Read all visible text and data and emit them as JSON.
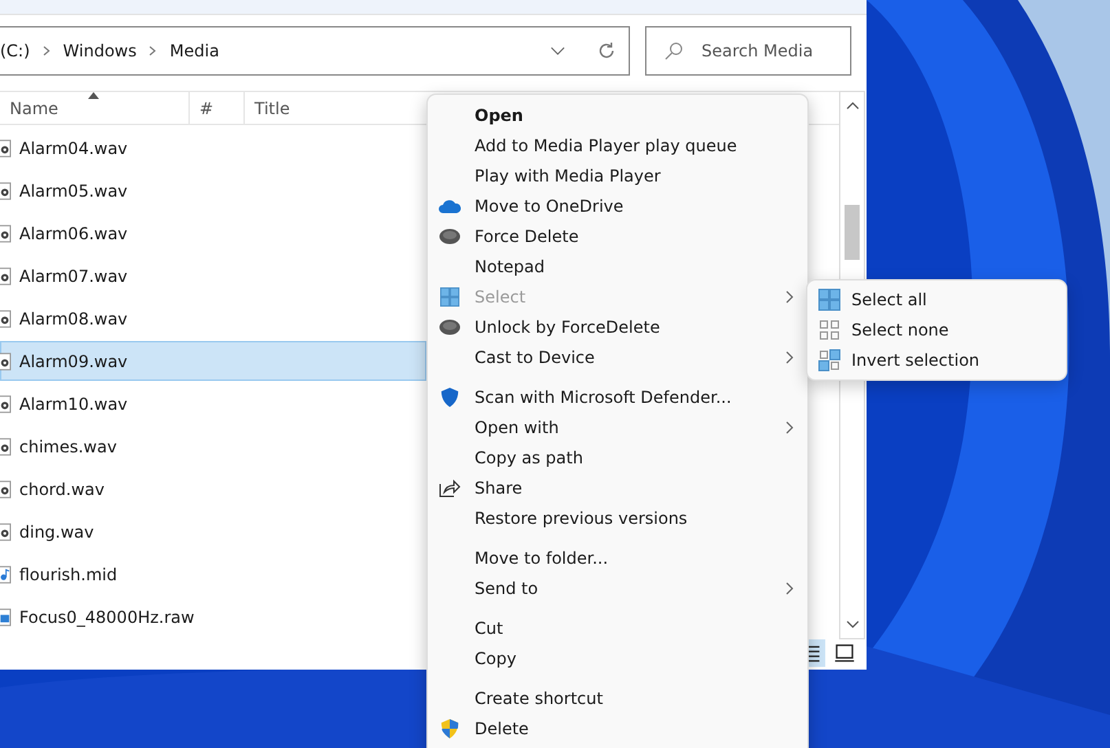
{
  "address_bar": {
    "path": [
      "(C:)",
      "Windows",
      "Media"
    ]
  },
  "search": {
    "placeholder": "Search Media"
  },
  "columns": [
    {
      "label": "Name",
      "sorted": true
    },
    {
      "label": "#",
      "sorted": false
    },
    {
      "label": "Title",
      "sorted": false
    }
  ],
  "files": [
    {
      "name": "Alarm04.wav",
      "kind": "audio",
      "selected": false
    },
    {
      "name": "Alarm05.wav",
      "kind": "audio",
      "selected": false
    },
    {
      "name": "Alarm06.wav",
      "kind": "audio",
      "selected": false
    },
    {
      "name": "Alarm07.wav",
      "kind": "audio",
      "selected": false
    },
    {
      "name": "Alarm08.wav",
      "kind": "audio",
      "selected": false
    },
    {
      "name": "Alarm09.wav",
      "kind": "audio",
      "selected": true
    },
    {
      "name": "Alarm10.wav",
      "kind": "audio",
      "selected": false
    },
    {
      "name": "chimes.wav",
      "kind": "audio",
      "selected": false
    },
    {
      "name": "chord.wav",
      "kind": "audio",
      "selected": false
    },
    {
      "name": "ding.wav",
      "kind": "audio",
      "selected": false
    },
    {
      "name": "flourish.mid",
      "kind": "midi",
      "selected": false
    },
    {
      "name": "Focus0_48000Hz.raw",
      "kind": "image",
      "selected": false
    }
  ],
  "context_menu": {
    "groups": [
      [
        {
          "label": "Open",
          "kind": "plain",
          "bold": true,
          "submenu": false,
          "disabled": false
        },
        {
          "label": "Add to Media Player play queue",
          "kind": "plain",
          "bold": false,
          "submenu": false,
          "disabled": false
        },
        {
          "label": "Play with Media Player",
          "kind": "plain",
          "bold": false,
          "submenu": false,
          "disabled": false
        },
        {
          "label": "Move to OneDrive",
          "kind": "cloud",
          "bold": false,
          "submenu": false,
          "disabled": false
        },
        {
          "label": "Force Delete",
          "kind": "disc",
          "bold": false,
          "submenu": false,
          "disabled": false
        },
        {
          "label": "Notepad",
          "kind": "plain",
          "bold": false,
          "submenu": false,
          "disabled": false
        },
        {
          "label": "Select",
          "kind": "grid",
          "bold": false,
          "submenu": true,
          "disabled": true
        },
        {
          "label": "Unlock by ForceDelete",
          "kind": "disc",
          "bold": false,
          "submenu": false,
          "disabled": false
        },
        {
          "label": "Cast to Device",
          "kind": "plain",
          "bold": false,
          "submenu": true,
          "disabled": false
        }
      ],
      [
        {
          "label": "Scan with Microsoft Defender...",
          "kind": "shield",
          "bold": false,
          "submenu": false,
          "disabled": false
        },
        {
          "label": "Open with",
          "kind": "plain",
          "bold": false,
          "submenu": true,
          "disabled": false
        },
        {
          "label": "Copy as path",
          "kind": "plain",
          "bold": false,
          "submenu": false,
          "disabled": false
        },
        {
          "label": "Share",
          "kind": "share",
          "bold": false,
          "submenu": false,
          "disabled": false
        },
        {
          "label": "Restore previous versions",
          "kind": "plain",
          "bold": false,
          "submenu": false,
          "disabled": false
        }
      ],
      [
        {
          "label": "Move to folder...",
          "kind": "plain",
          "bold": false,
          "submenu": false,
          "disabled": false
        },
        {
          "label": "Send to",
          "kind": "plain",
          "bold": false,
          "submenu": true,
          "disabled": false
        }
      ],
      [
        {
          "label": "Cut",
          "kind": "plain",
          "bold": false,
          "submenu": false,
          "disabled": false
        },
        {
          "label": "Copy",
          "kind": "plain",
          "bold": false,
          "submenu": false,
          "disabled": false
        }
      ],
      [
        {
          "label": "Create shortcut",
          "kind": "plain",
          "bold": false,
          "submenu": false,
          "disabled": false
        },
        {
          "label": "Delete",
          "kind": "uac",
          "bold": false,
          "submenu": false,
          "disabled": false
        }
      ]
    ]
  },
  "submenu": [
    {
      "label": "Select all",
      "kind": "all"
    },
    {
      "label": "Select none",
      "kind": "none"
    },
    {
      "label": "Invert selection",
      "kind": "invert"
    }
  ]
}
